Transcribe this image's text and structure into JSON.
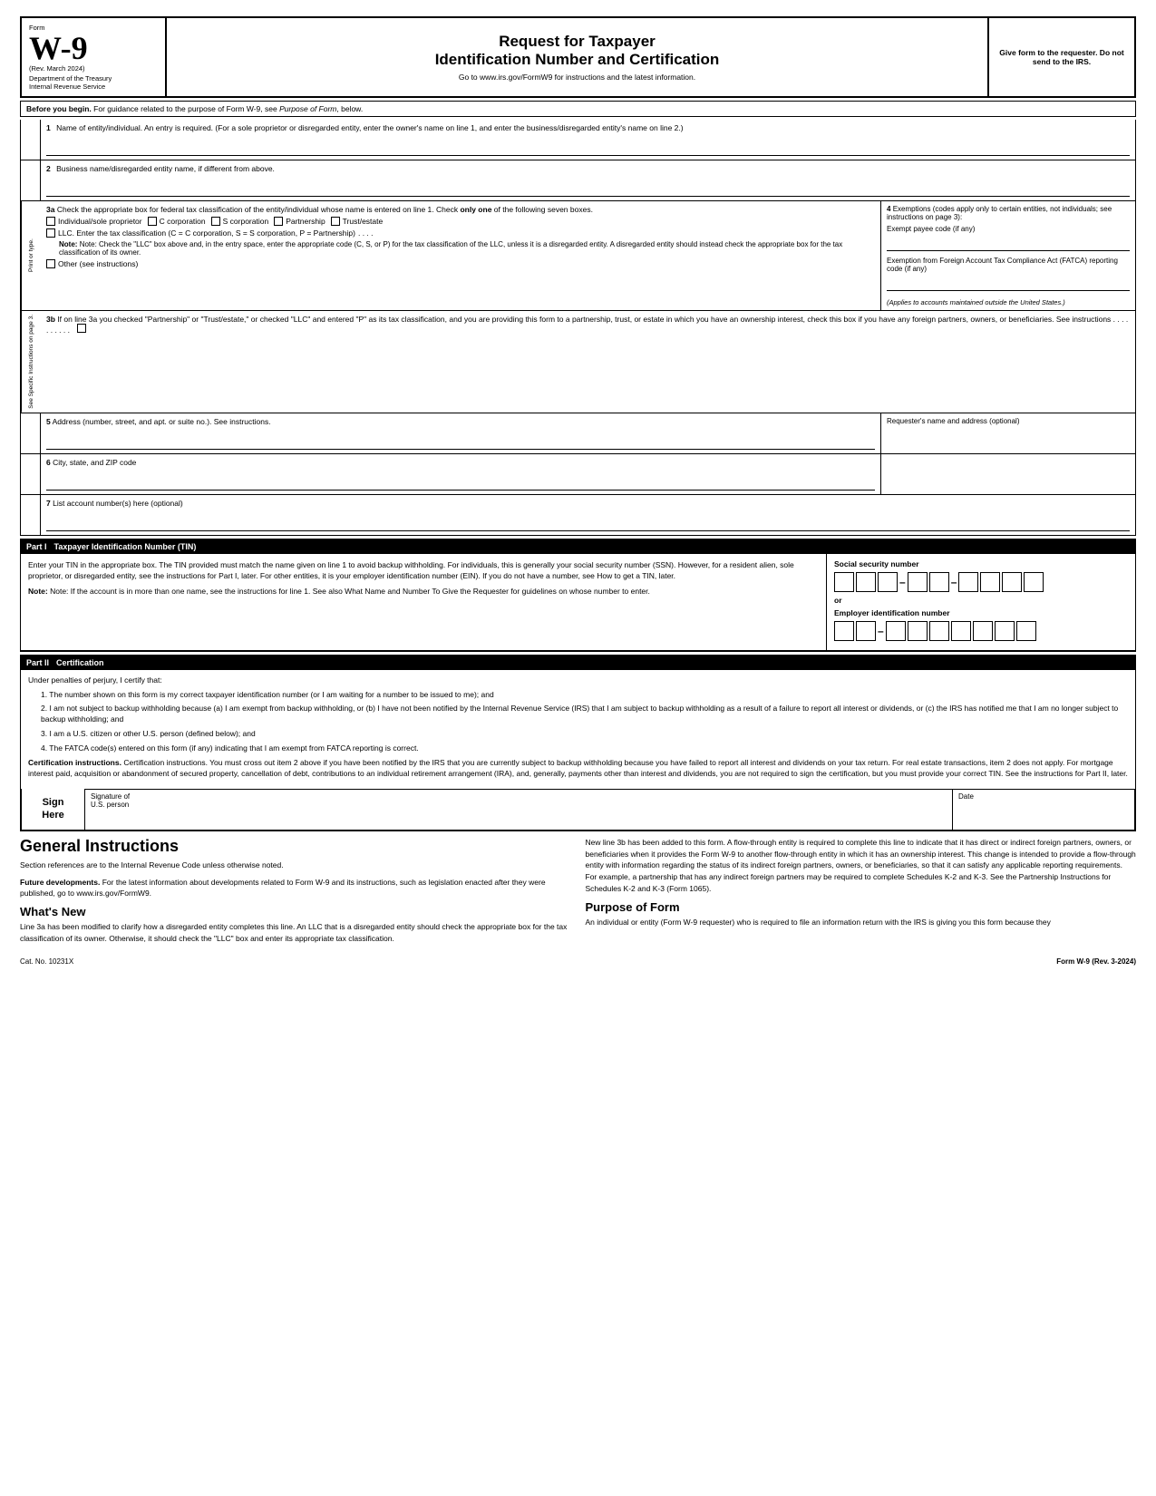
{
  "header": {
    "form_label": "Form",
    "w9": "W-9",
    "rev": "(Rev. March 2024)",
    "dept": "Department of the Treasury",
    "irs": "Internal Revenue Service",
    "title_main": "Request for Taxpayer",
    "title_sub": "Identification Number and Certification",
    "subtitle": "Go to www.irs.gov/FormW9 for instructions and the latest information.",
    "give_form": "Give form to the requester. Do not send to the IRS."
  },
  "before_begin": {
    "text": "Before you begin. For guidance related to the purpose of Form W-9, see Purpose of Form, below."
  },
  "fields": {
    "field1_label": "Name of entity/individual. An entry is required. (For a sole proprietor or disregarded entity, enter the owner's name on line 1, and enter the business/disregarded entity's name on line 2.)",
    "field1_num": "1",
    "field2_label": "Business name/disregarded entity name, if different from above.",
    "field2_num": "2",
    "field3a_num": "3a",
    "field3a_label": "Check the appropriate box for federal tax classification of the entity/individual whose name is entered on line 1. Check only one of the following seven boxes.",
    "cb_individual": "Individual/sole proprietor",
    "cb_ccorp": "C corporation",
    "cb_scorp": "S corporation",
    "cb_partnership": "Partnership",
    "cb_trust": "Trust/estate",
    "cb_llc": "LLC. Enter the tax classification (C = C corporation, S = S corporation, P = Partnership)",
    "note_3a": "Note: Check the \"LLC\" box above and, in the entry space, enter the appropriate code (C, S, or P) for the tax classification of the LLC, unless it is a disregarded entity. A disregarded entity should instead check the appropriate box for the tax classification of its owner.",
    "cb_other": "Other (see instructions)",
    "field3b_num": "3b",
    "field3b_text": "If on line 3a you checked \"Partnership\" or \"Trust/estate,\" or checked \"LLC\" and entered \"P\" as its tax classification, and you are providing this form to a partnership, trust, or estate in which you have an ownership interest, check this box if you have any foreign partners, owners, or beneficiaries. See instructions . . . . . . . . . .",
    "field4_num": "4",
    "field4_label": "Exemptions (codes apply only to certain entities, not individuals; see instructions on page 3):",
    "field4_exempt": "Exempt payee code (if any)",
    "field4_fatca": "Exemption from Foreign Account Tax Compliance Act (FATCA) reporting code (if any)",
    "field4_applies": "(Applies to accounts maintained outside the United States.)",
    "field5_num": "5",
    "field5_label": "Address (number, street, and apt. or suite no.). See instructions.",
    "field5_requester": "Requester's name and address (optional)",
    "field6_num": "6",
    "field6_label": "City, state, and ZIP code",
    "field7_num": "7",
    "field7_label": "List account number(s) here (optional)"
  },
  "side_label": "See Specific Instructions on page 3.",
  "print_label": "Print or type.",
  "part1": {
    "part_label": "Part I",
    "title": "Taxpayer Identification Number (TIN)",
    "body": "Enter your TIN in the appropriate box. The TIN provided must match the name given on line 1 to avoid backup withholding. For individuals, this is generally your social security number (SSN). However, for a resident alien, sole proprietor, or disregarded entity, see the instructions for Part I, later. For other entities, it is your employer identification number (EIN). If you do not have a number, see How to get a TIN, later.",
    "note": "Note: If the account is in more than one name, see the instructions for line 1. See also What Name and Number To Give the Requester for guidelines on whose number to enter.",
    "ssn_label": "Social security number",
    "or_label": "or",
    "ein_label": "Employer identification number"
  },
  "part2": {
    "part_label": "Part II",
    "title": "Certification",
    "under_penalties": "Under penalties of perjury, I certify that:",
    "item1": "1. The number shown on this form is my correct taxpayer identification number (or I am waiting for a number to be issued to me); and",
    "item2": "2. I am not subject to backup withholding because (a) I am exempt from backup withholding, or (b) I have not been notified by the Internal Revenue Service (IRS) that I am subject to backup withholding as a result of a failure to report all interest or dividends, or (c) the IRS has notified me that I am no longer subject to backup withholding; and",
    "item3": "3. I am a U.S. citizen or other U.S. person (defined below); and",
    "item4": "4. The FATCA code(s) entered on this form (if any) indicating that I am exempt from FATCA reporting is correct.",
    "cert_instructions": "Certification instructions. You must cross out item 2 above if you have been notified by the IRS that you are currently subject to backup withholding because you have failed to report all interest and dividends on your tax return. For real estate transactions, item 2 does not apply. For mortgage interest paid, acquisition or abandonment of secured property, cancellation of debt, contributions to an individual retirement arrangement (IRA), and, generally, payments other than interest and dividends, you are not required to sign the certification, but you must provide your correct TIN. See the instructions for Part II, later."
  },
  "sign": {
    "sign_here": "Sign\nHere",
    "signature_of": "Signature of",
    "us_person": "U.S. person",
    "date_label": "Date"
  },
  "general": {
    "title": "General Instructions",
    "section_refs": "Section references are to the Internal Revenue Code unless otherwise noted.",
    "future_dev_bold": "Future developments.",
    "future_dev": " For the latest information about developments related to Form W-9 and its instructions, such as legislation enacted after they were published, go to www.irs.gov/FormW9.",
    "whats_new_title": "What's New",
    "whats_new": "Line 3a has been modified to clarify how a disregarded entity completes this line. An LLC that is a disregarded entity should check the appropriate box for the tax classification of its owner. Otherwise, it should check the \"LLC\" box and enter its appropriate tax classification.",
    "right_col": "New line 3b has been added to this form. A flow-through entity is required to complete this line to indicate that it has direct or indirect foreign partners, owners, or beneficiaries when it provides the Form W-9 to another flow-through entity in which it has an ownership interest. This change is intended to provide a flow-through entity with information regarding the status of its indirect foreign partners, owners, or beneficiaries, so that it can satisfy any applicable reporting requirements. For example, a partnership that has any indirect foreign partners may be required to complete Schedules K-2 and K-3. See the Partnership Instructions for Schedules K-2 and K-3 (Form 1065).",
    "purpose_title": "Purpose of Form",
    "purpose": "An individual or entity (Form W-9 requester) who is required to file an information return with the IRS is giving you this form because they",
    "cat_no": "Cat. No. 10231X",
    "form_ref": "Form W-9 (Rev. 3-2024)"
  }
}
